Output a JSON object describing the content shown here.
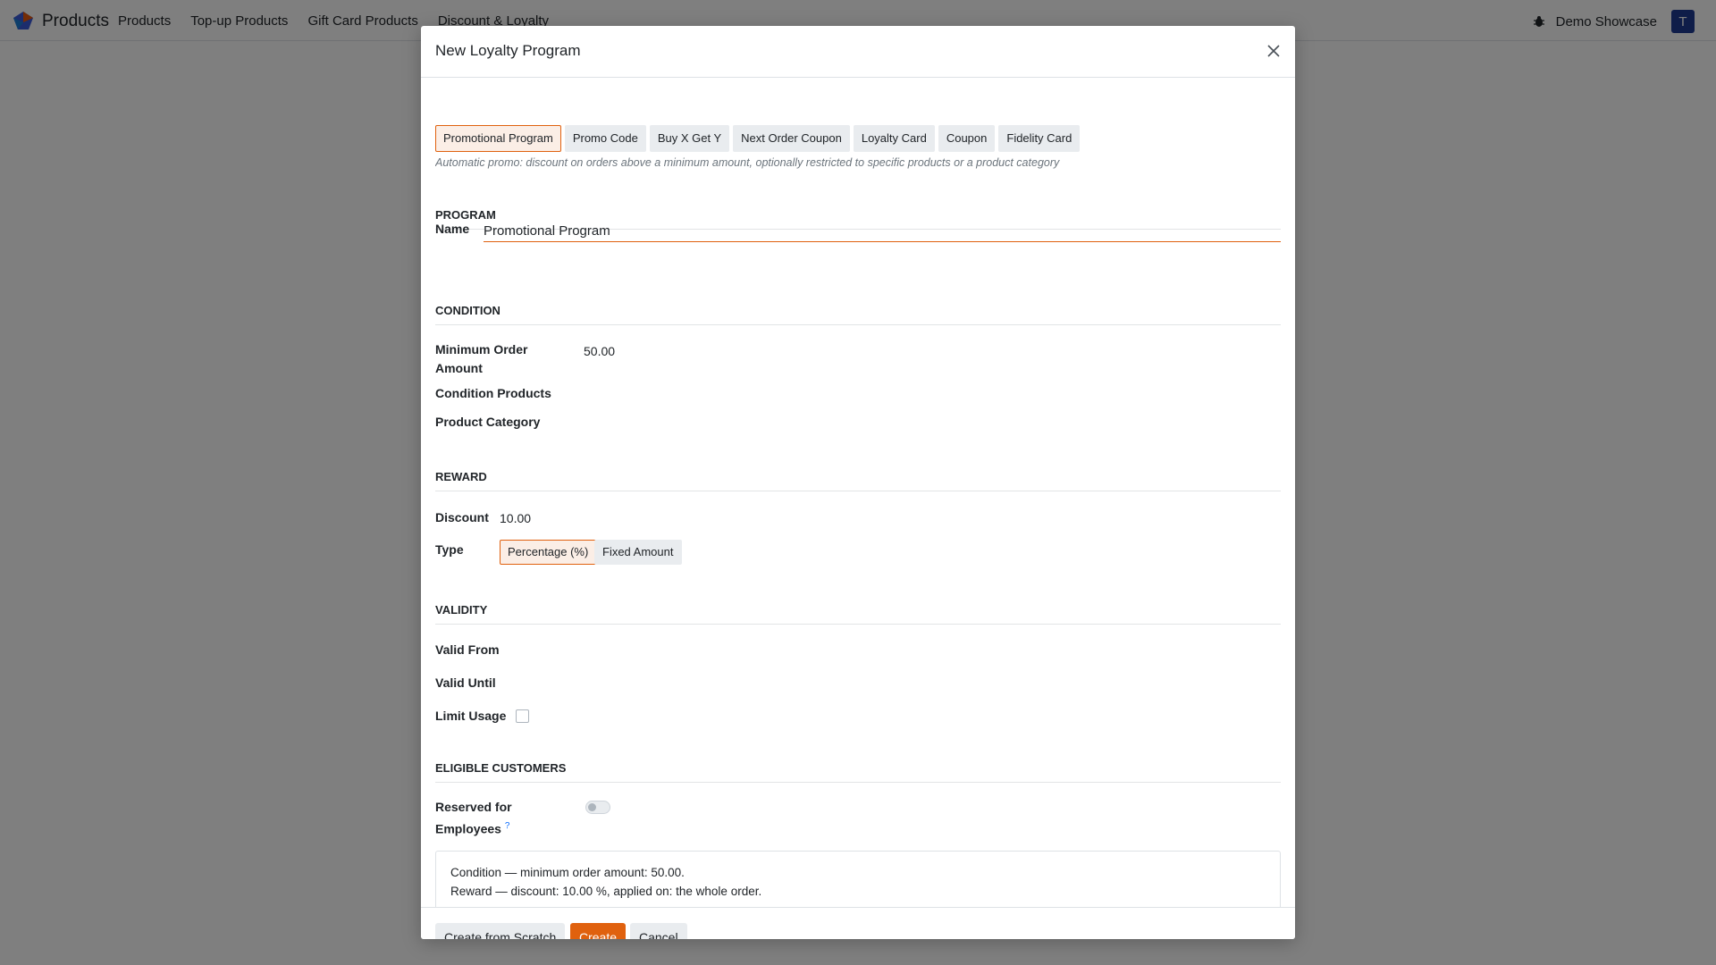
{
  "navbar": {
    "app_name": "Products",
    "menu": [
      "Products",
      "Top-up Products",
      "Gift Card Products",
      "Discount & Loyalty"
    ],
    "company": "Demo Showcase",
    "avatar_initial": "T"
  },
  "modal": {
    "title": "New Loyalty Program",
    "program_types": [
      "Promotional Program",
      "Promo Code",
      "Buy X Get Y",
      "Next Order Coupon",
      "Loyalty Card",
      "Coupon",
      "Fidelity Card"
    ],
    "active_program_type": "Promotional Program",
    "description": "Automatic promo: discount on orders above a minimum amount, optionally restricted to specific products or a product category",
    "sections": {
      "program": "PROGRAM",
      "condition": "CONDITION",
      "reward": "REWARD",
      "validity": "VALIDITY",
      "eligible": "ELIGIBLE CUSTOMERS"
    },
    "program": {
      "name_label": "Name",
      "name_value": "Promotional Program"
    },
    "condition": {
      "min_order_label": "Minimum Order Amount",
      "min_order_value": "50.00",
      "condition_products_label": "Condition Products",
      "product_category_label": "Product Category"
    },
    "reward": {
      "discount_label": "Discount",
      "discount_value": "10.00",
      "type_label": "Type",
      "type_options": [
        "Percentage (%)",
        "Fixed Amount"
      ],
      "type_selected": "Percentage (%)"
    },
    "validity": {
      "valid_from_label": "Valid From",
      "valid_until_label": "Valid Until",
      "limit_usage_label": "Limit Usage",
      "limit_usage_checked": false
    },
    "eligible": {
      "reserved_label": "Reserved for Employees",
      "reserved_help": "?",
      "reserved_enabled": false
    },
    "summary": {
      "line1": "Condition — minimum order amount: 50.00.",
      "line2": "Reward — discount: 10.00 %, applied on: the whole order."
    },
    "footer": {
      "create_from_scratch": "Create from Scratch",
      "create": "Create",
      "cancel": "Cancel"
    }
  },
  "colors": {
    "accent": "#e0610e",
    "accent_bg": "#fbeee6",
    "avatar": "#1f3a93"
  }
}
